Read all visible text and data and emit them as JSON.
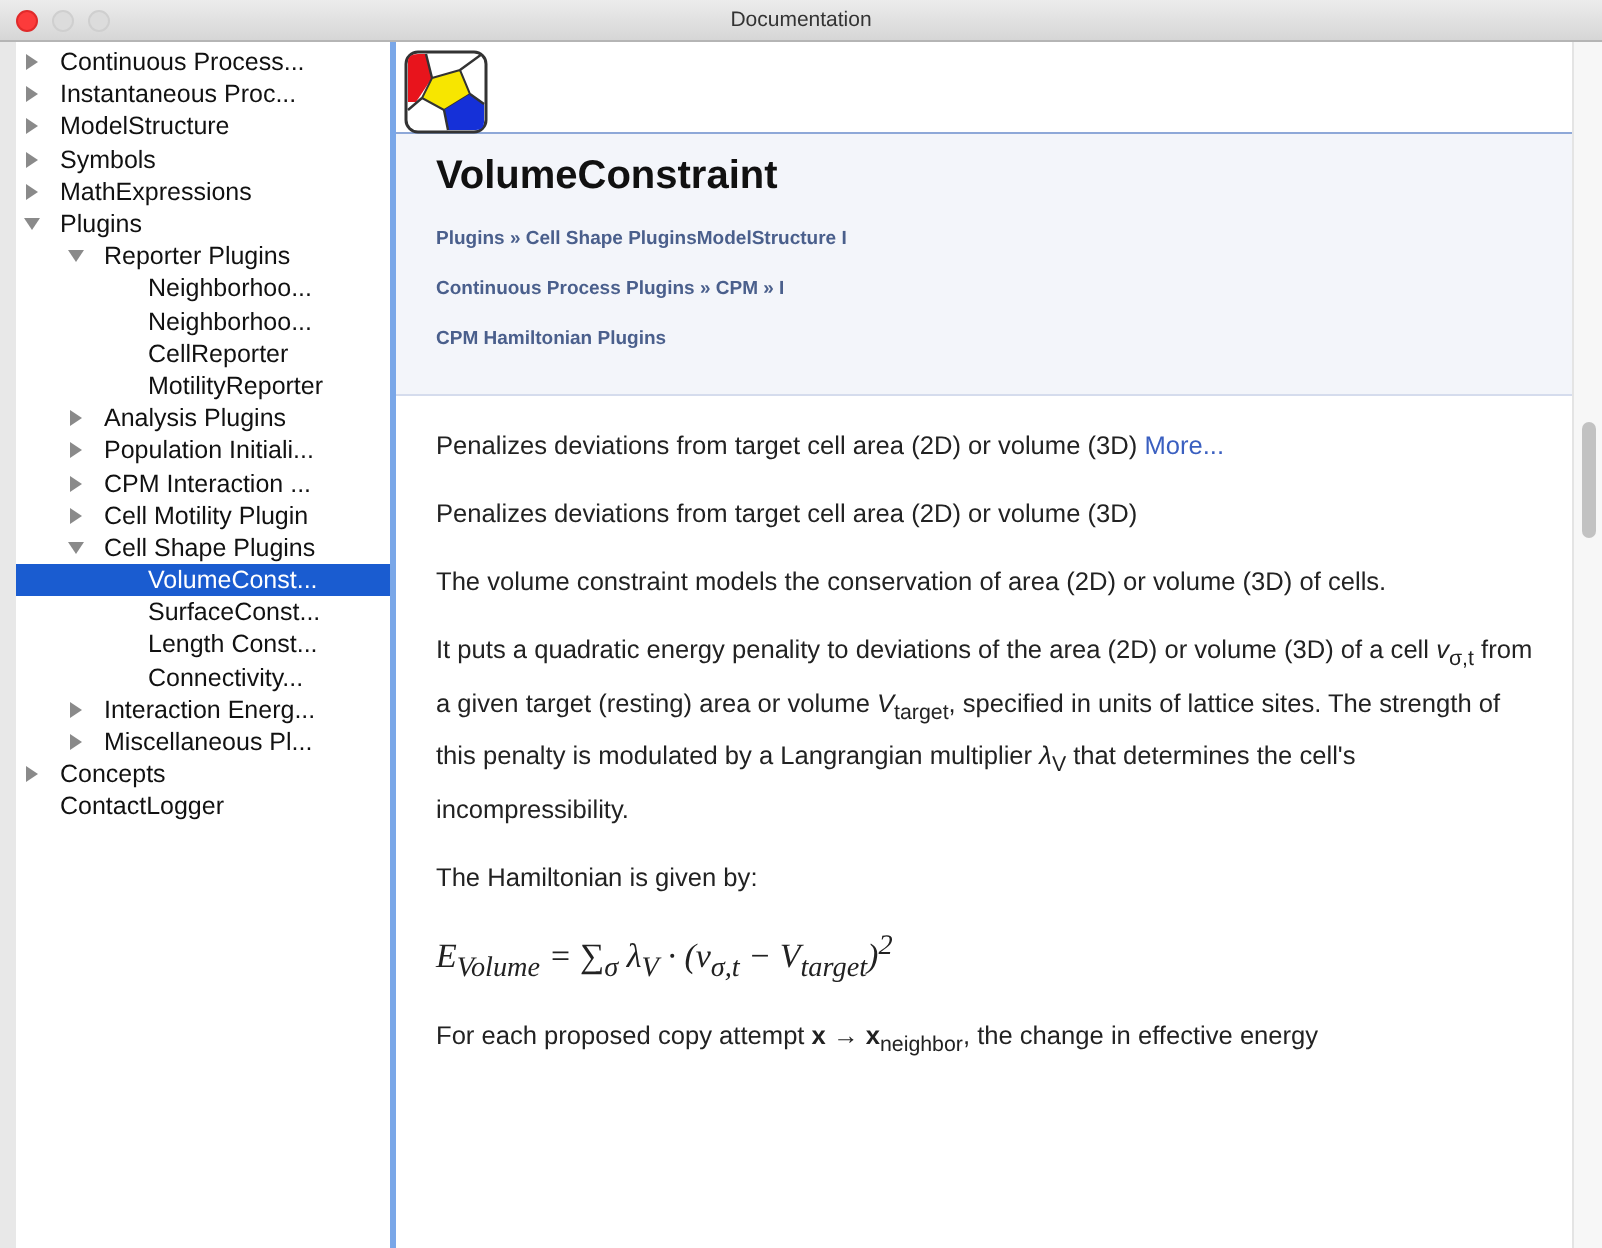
{
  "window": {
    "title": "Documentation"
  },
  "tree": [
    {
      "label": "Continuous Process...",
      "expanded": false,
      "selected": false
    },
    {
      "label": "Instantaneous Proc...",
      "expanded": false,
      "selected": false
    },
    {
      "label": "ModelStructure",
      "expanded": false,
      "selected": false
    },
    {
      "label": "Symbols",
      "expanded": false,
      "selected": false
    },
    {
      "label": "MathExpressions",
      "expanded": false,
      "selected": false
    },
    {
      "label": "Plugins",
      "expanded": true,
      "selected": false,
      "children": [
        {
          "label": "Reporter Plugins",
          "expanded": true,
          "selected": false,
          "children": [
            {
              "label": "Neighborhoo...",
              "selected": false
            },
            {
              "label": "Neighborhoo...",
              "selected": false
            },
            {
              "label": "CellReporter",
              "selected": false
            },
            {
              "label": "MotilityReporter",
              "selected": false
            }
          ]
        },
        {
          "label": "Analysis Plugins",
          "expanded": false,
          "selected": false
        },
        {
          "label": "Population Initiali...",
          "expanded": false,
          "selected": false
        },
        {
          "label": "CPM Interaction ...",
          "expanded": false,
          "selected": false
        },
        {
          "label": "Cell Motility Plugin",
          "expanded": false,
          "selected": false
        },
        {
          "label": "Cell Shape Plugins",
          "expanded": true,
          "selected": false,
          "children": [
            {
              "label": "VolumeConst...",
              "selected": true
            },
            {
              "label": "SurfaceConst...",
              "selected": false
            },
            {
              "label": "Length Const...",
              "selected": false
            },
            {
              "label": "Connectivity...",
              "selected": false
            }
          ]
        },
        {
          "label": "Interaction Energ...",
          "expanded": false,
          "selected": false
        },
        {
          "label": "Miscellaneous Pl...",
          "expanded": false,
          "selected": false
        }
      ]
    },
    {
      "label": "Concepts",
      "expanded": false,
      "selected": false
    },
    {
      "label": "ContactLogger",
      "selected": false
    }
  ],
  "doc": {
    "title": "VolumeConstraint",
    "breadcrumbs": [
      "Plugins » Cell Shape PluginsModelStructure I",
      "Continuous Process Plugins » CPM » I",
      "CPM Hamiltonian Plugins"
    ],
    "summary": "Penalizes deviations from target cell area (2D) or volume (3D)",
    "more_link": "More...",
    "paragraphs": [
      {
        "kind": "text",
        "text": "Penalizes deviations from target cell area (2D) or volume (3D)"
      },
      {
        "kind": "text",
        "text": "The volume constraint models the conservation of area (2D) or volume (3D) of cells."
      },
      {
        "kind": "text",
        "text": "It puts a quadratic energy penality to deviations of the area (2D) or volume (3D) of a cell *v*$_{σ,t}$ from a given target (resting) area or volume *V*$_{target}$, specified in units of lattice sites. The strength of this penalty is modulated by a Langrangian multiplier *λ*$_{V}$ that determines the cell's incompressibility."
      },
      {
        "kind": "text",
        "text": "The Hamiltonian is given by:"
      },
      {
        "kind": "formula",
        "text": "*E*$_{Volume}$ = ∑$_{σ}$ *λ*$_{V}$ · (*v*$_{σ,t}$ − *V*$_{target}$)$^{2}$"
      },
      {
        "kind": "text",
        "text": "For each proposed copy attempt **x** → **x**$_{neighbor}$, the change in effective energy"
      }
    ]
  }
}
